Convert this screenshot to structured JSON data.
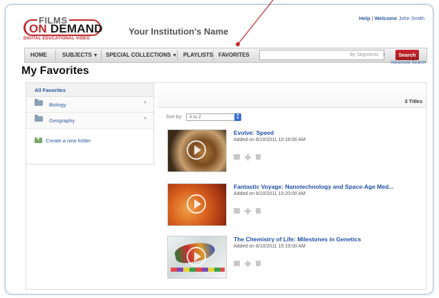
{
  "header": {
    "logo": {
      "films": "FILMS",
      "on": "ON",
      "demand": "DEMAND",
      "tagline": "DIGITAL EDUCATIONAL VIDEO"
    },
    "institution": "Your Institution's Name",
    "help": "Help",
    "welcome": "Welcome",
    "user": "John Smith"
  },
  "nav": {
    "items": [
      "HOME",
      "SUBJECTS",
      "SPECIAL COLLECTIONS",
      "PLAYLISTS",
      "FAVORITES"
    ],
    "search_placeholder": "",
    "segments": "By Segments",
    "search_button": "Search",
    "advanced": "Advanced Search"
  },
  "page_title": "My Favorites",
  "sidebar": {
    "all": "All Favorites",
    "folders": [
      "Biology",
      "Geography"
    ],
    "new_folder": "Create a new folder"
  },
  "main": {
    "count": "3 Titles",
    "sort_label": "Sort by:",
    "sort_value": "A to Z",
    "items": [
      {
        "title": "Evolve: Speed",
        "added": "Added on 8/10/2011 10:18:00 AM"
      },
      {
        "title": "Fantastic Voyage: Nanotechnology and Space-Age Med...",
        "added": "Added on 8/10/2011 10:20:00 AM"
      },
      {
        "title": "The Chemistry of Life: Milestones in Genetics",
        "added": "Added on 8/10/2011 10:19:00 AM"
      }
    ]
  },
  "colors": {
    "brand_red": "#c0272d",
    "link_blue": "#1f4fa3",
    "frame": "#a9c2d8"
  }
}
